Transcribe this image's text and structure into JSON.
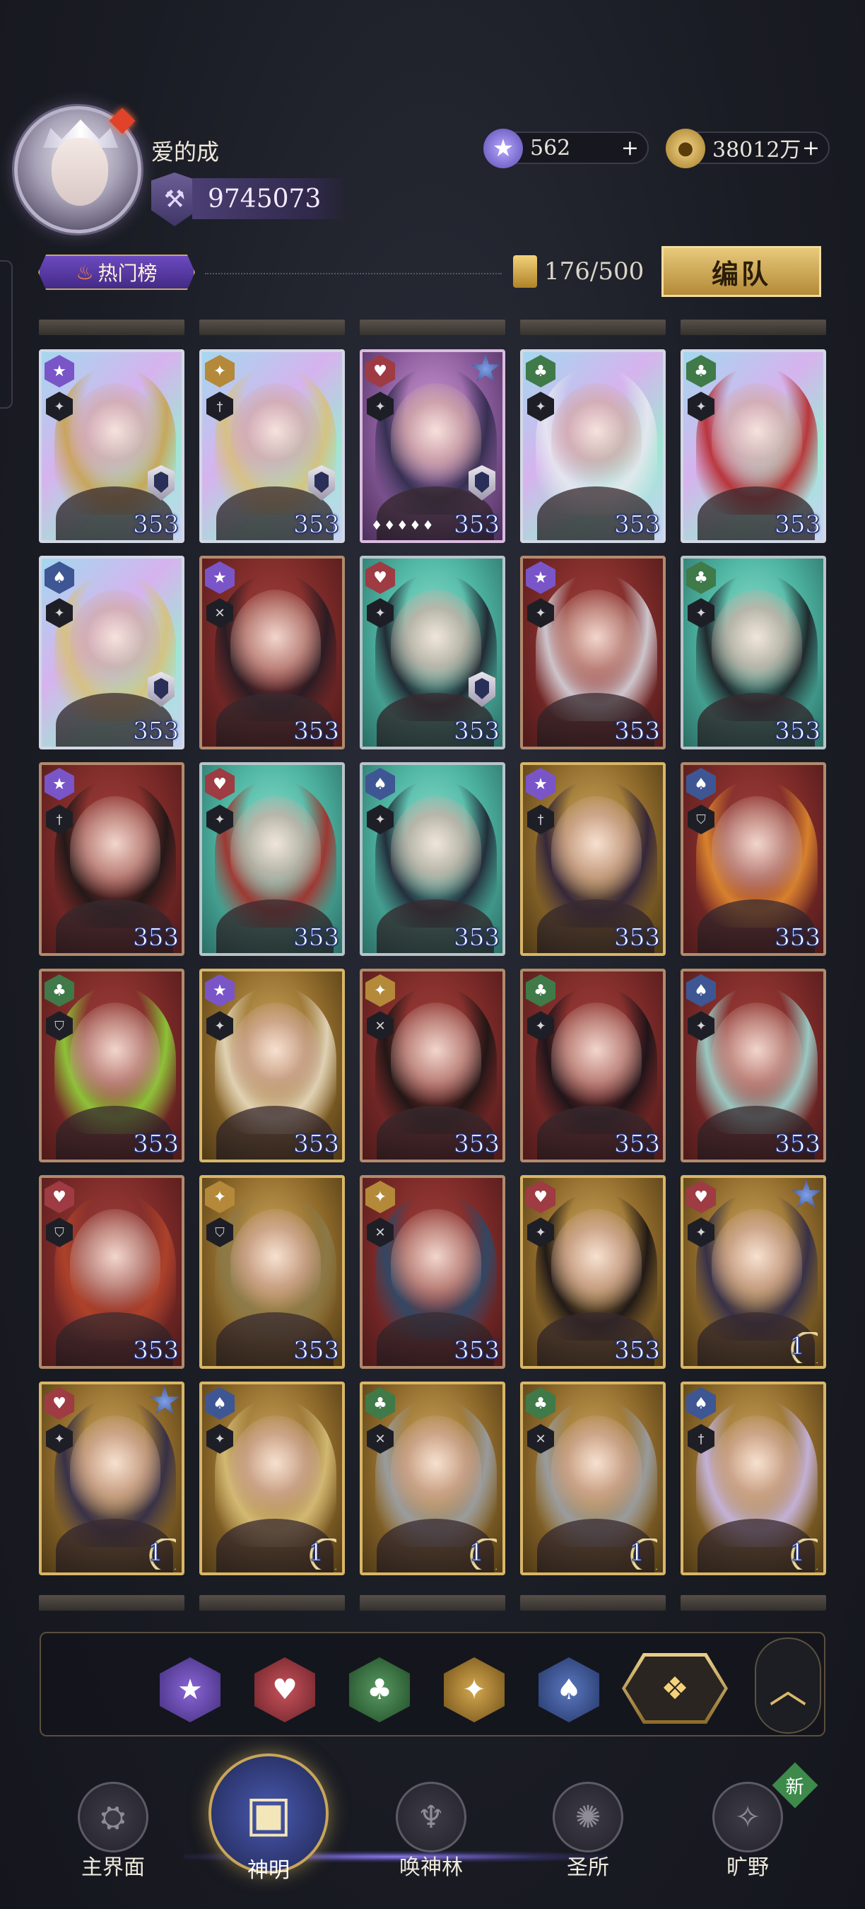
{
  "player": {
    "name": "爱的成",
    "power": "9745073"
  },
  "resources": {
    "crystal": "562",
    "gold": "38012万",
    "plus": "+"
  },
  "tabs": {
    "hot": "热门榜"
  },
  "roster": {
    "count": "176/500",
    "team_button": "编队"
  },
  "cards": [
    {
      "suit": "star",
      "suit_icon": "★",
      "role_icon": "✦",
      "bg": "holo",
      "hair": "#c9a24f",
      "level": "353",
      "shield": true
    },
    {
      "suit": "diamond",
      "suit_icon": "✦",
      "role_icon": "†",
      "bg": "holo",
      "hair": "#d8c07a",
      "level": "353",
      "shield": true
    },
    {
      "suit": "heart",
      "suit_icon": "♥",
      "role_icon": "✦",
      "bg": "purple",
      "hair": "#2d2a4a",
      "level": "353",
      "shield": true,
      "star_corner": true,
      "stars": "♦♦♦♦♦"
    },
    {
      "suit": "club",
      "suit_icon": "♣",
      "role_icon": "✦",
      "bg": "holo",
      "hair": "#e8e8f0",
      "level": "353",
      "shield": false
    },
    {
      "suit": "club",
      "suit_icon": "♣",
      "role_icon": "✦",
      "bg": "holo",
      "hair": "#b8262a",
      "level": "353",
      "shield": false
    },
    {
      "suit": "spade",
      "suit_icon": "♠",
      "role_icon": "✦",
      "bg": "holo",
      "hair": "#d8c07a",
      "level": "353",
      "shield": true
    },
    {
      "suit": "star",
      "suit_icon": "★",
      "role_icon": "✕",
      "bg": "red",
      "hair": "#221a22",
      "level": "353",
      "shield": false
    },
    {
      "suit": "heart",
      "suit_icon": "♥",
      "role_icon": "✦",
      "bg": "teal",
      "hair": "#1c1c28",
      "level": "353",
      "shield": true
    },
    {
      "suit": "star",
      "suit_icon": "★",
      "role_icon": "✦",
      "bg": "red",
      "hair": "#d6d6de",
      "level": "353",
      "shield": false
    },
    {
      "suit": "club",
      "suit_icon": "♣",
      "role_icon": "✦",
      "bg": "teal",
      "hair": "#1a1a20",
      "level": "353",
      "shield": false
    },
    {
      "suit": "star",
      "suit_icon": "★",
      "role_icon": "†",
      "bg": "red",
      "hair": "#1a1616",
      "level": "353",
      "shield": false
    },
    {
      "suit": "heart",
      "suit_icon": "♥",
      "role_icon": "✦",
      "bg": "teal",
      "hair": "#a62a26",
      "level": "353",
      "shield": false
    },
    {
      "suit": "spade",
      "suit_icon": "♠",
      "role_icon": "✦",
      "bg": "teal",
      "hair": "#1e2030",
      "level": "353",
      "shield": false
    },
    {
      "suit": "star",
      "suit_icon": "★",
      "role_icon": "†",
      "bg": "gold",
      "hair": "#2a1f3a",
      "level": "353",
      "shield": false
    },
    {
      "suit": "spade",
      "suit_icon": "♠",
      "role_icon": "⛉",
      "bg": "red",
      "hair": "#e08a2e",
      "level": "353",
      "shield": false
    },
    {
      "suit": "club",
      "suit_icon": "♣",
      "role_icon": "⛉",
      "bg": "red",
      "hair": "#8fd23a",
      "level": "353",
      "shield": false
    },
    {
      "suit": "star",
      "suit_icon": "★",
      "role_icon": "✦",
      "bg": "gold",
      "hair": "#e8dcc2",
      "level": "353",
      "shield": false
    },
    {
      "suit": "diamond",
      "suit_icon": "✦",
      "role_icon": "✕",
      "bg": "red",
      "hair": "#181414",
      "level": "353",
      "shield": false
    },
    {
      "suit": "club",
      "suit_icon": "♣",
      "role_icon": "✦",
      "bg": "red",
      "hair": "#151218",
      "level": "353",
      "shield": false
    },
    {
      "suit": "spade",
      "suit_icon": "♠",
      "role_icon": "✦",
      "bg": "red",
      "hair": "#9ed8d2",
      "level": "353",
      "shield": false
    },
    {
      "suit": "heart",
      "suit_icon": "♥",
      "role_icon": "⛉",
      "bg": "red",
      "hair": "#b2442a",
      "level": "353",
      "shield": false
    },
    {
      "suit": "diamond",
      "suit_icon": "✦",
      "role_icon": "⛉",
      "bg": "gold",
      "hair": "#8a7a4a",
      "level": "353",
      "shield": false
    },
    {
      "suit": "diamond",
      "suit_icon": "✦",
      "role_icon": "✕",
      "bg": "red",
      "hair": "#2a4a6a",
      "level": "353",
      "shield": false
    },
    {
      "suit": "heart",
      "suit_icon": "♥",
      "role_icon": "✦",
      "bg": "gold",
      "hair": "#141014",
      "level": "353",
      "shield": false
    },
    {
      "suit": "heart",
      "suit_icon": "♥",
      "role_icon": "✦",
      "bg": "gold",
      "hair": "#2d2a4a",
      "level": "1",
      "shield": false,
      "star_corner": true,
      "moon": true
    },
    {
      "suit": "heart",
      "suit_icon": "♥",
      "role_icon": "✦",
      "bg": "gold",
      "hair": "#2d2a4a",
      "level": "1",
      "shield": false,
      "star_corner": true,
      "moon": true
    },
    {
      "suit": "spade",
      "suit_icon": "♠",
      "role_icon": "✦",
      "bg": "gold",
      "hair": "#d8c07a",
      "level": "1",
      "shield": false,
      "moon": true
    },
    {
      "suit": "club",
      "suit_icon": "♣",
      "role_icon": "✕",
      "bg": "gold",
      "hair": "#9aa0a8",
      "level": "1",
      "shield": false,
      "moon": true
    },
    {
      "suit": "club",
      "suit_icon": "♣",
      "role_icon": "✕",
      "bg": "gold",
      "hair": "#9aa0a8",
      "level": "1",
      "shield": false,
      "moon": true
    },
    {
      "suit": "spade",
      "suit_icon": "♠",
      "role_icon": "†",
      "bg": "gold",
      "hair": "#c8b8e8",
      "level": "1",
      "shield": false,
      "moon": true
    }
  ],
  "filters": [
    {
      "name": "star",
      "icon": "★"
    },
    {
      "name": "heart",
      "icon": "♥"
    },
    {
      "name": "club",
      "icon": "♣"
    },
    {
      "name": "diamond",
      "icon": "✦"
    },
    {
      "name": "spade",
      "icon": "♠"
    }
  ],
  "filter_all_icon": "❖",
  "collapse_icon": "︿",
  "nav": [
    {
      "key": "realm",
      "label": "主界面",
      "icon": "⛭",
      "active": false
    },
    {
      "key": "gods",
      "label": "神明",
      "icon": "▣",
      "active": true
    },
    {
      "key": "grove",
      "label": "唤神林",
      "icon": "♆",
      "active": false
    },
    {
      "key": "sanctuary",
      "label": "圣所",
      "icon": "✺",
      "active": false
    },
    {
      "key": "wild",
      "label": "旷野",
      "icon": "✧",
      "active": false
    }
  ],
  "new_badge": "新"
}
